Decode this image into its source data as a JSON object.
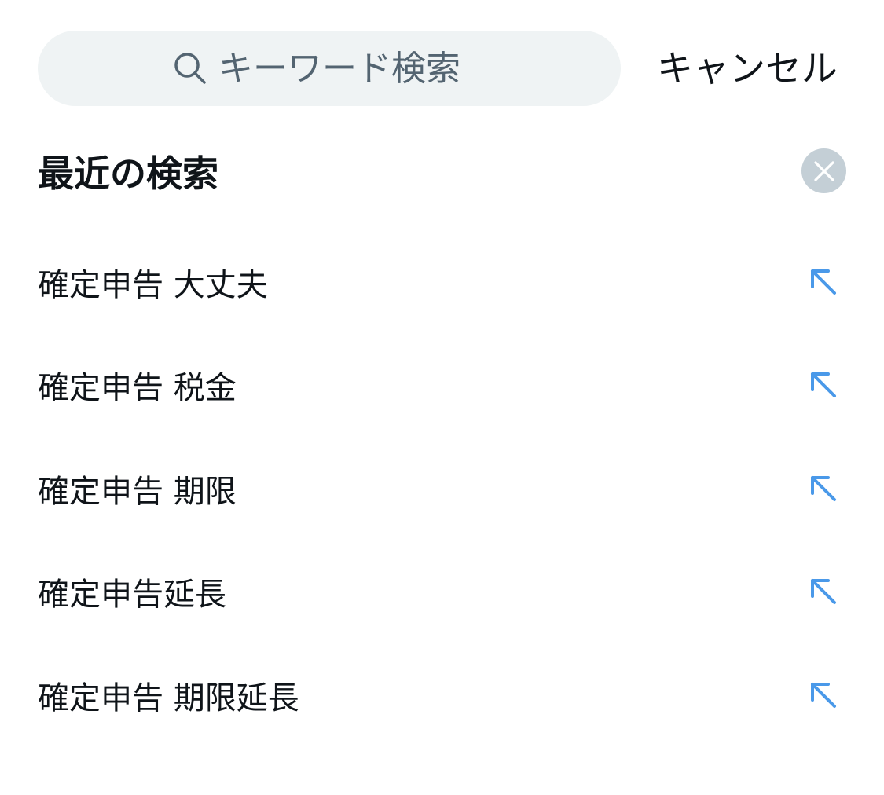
{
  "search": {
    "placeholder": "キーワード検索",
    "icon": "search-icon"
  },
  "header": {
    "cancel_label": "キャンセル"
  },
  "recent": {
    "title": "最近の検索",
    "clear_icon": "close-icon",
    "items": [
      {
        "label": "確定申告 大丈夫",
        "icon": "arrow-up-left-icon"
      },
      {
        "label": "確定申告 税金",
        "icon": "arrow-up-left-icon"
      },
      {
        "label": "確定申告 期限",
        "icon": "arrow-up-left-icon"
      },
      {
        "label": "確定申告延長",
        "icon": "arrow-up-left-icon"
      },
      {
        "label": "確定申告 期限延長",
        "icon": "arrow-up-left-icon"
      }
    ]
  },
  "colors": {
    "search_background": "#eff3f4",
    "placeholder_text": "#536471",
    "clear_button": "#c4cfd6",
    "accent": "#4a99e9",
    "text": "#0f1419"
  }
}
